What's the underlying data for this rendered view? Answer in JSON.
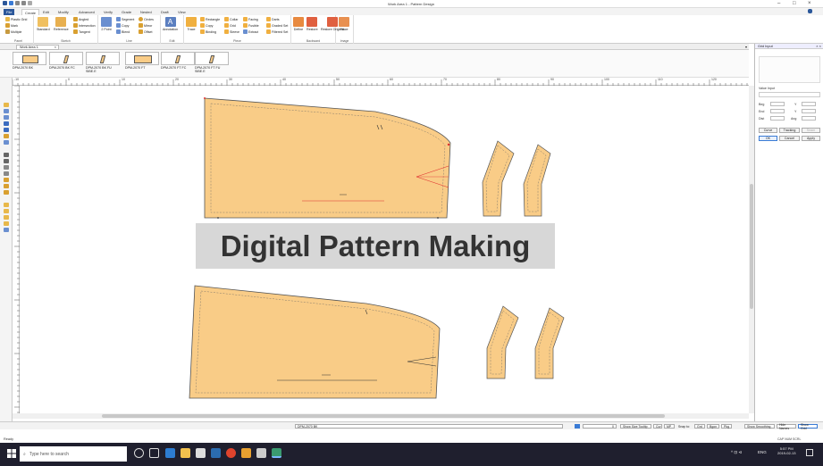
{
  "window": {
    "title": "Work Area 1 - Pattern Design"
  },
  "menu": {
    "items": [
      "File",
      "Create",
      "Edit",
      "Modify",
      "Advanced",
      "Verify",
      "Grade",
      "Nested",
      "Draft",
      "View"
    ]
  },
  "ribbon": {
    "groups": [
      {
        "label": "Panel",
        "items": [
          "Plastic Grid",
          "Mark",
          "Multiple"
        ]
      },
      {
        "label": "Sketch",
        "items": [
          "Standard",
          "Reference",
          "Angled",
          "Intersection",
          "Tangent"
        ]
      },
      {
        "label": "Line",
        "items": [
          "2 Point",
          "Segment",
          "Copy",
          "Blend",
          "Circles",
          "Mirror",
          "Offset"
        ]
      },
      {
        "label": "Edit",
        "items": [
          "Annotation"
        ]
      },
      {
        "label": "Piece",
        "items": [
          "Trace",
          "Rectangle",
          "Copy",
          "Binding",
          "Collar",
          "Grid",
          "Sleeve",
          "Facing",
          "Fusible",
          "Extract",
          "Darts",
          "Graded Set",
          "Filtered Set"
        ]
      },
      {
        "label": "Backward",
        "items": [
          "Define",
          "Restore",
          "Restore Original",
          "Defined"
        ]
      },
      {
        "label": "Image",
        "items": [
          "Place"
        ]
      }
    ]
  },
  "doc_tab": {
    "label": "Work Area 1"
  },
  "thumbnails": [
    {
      "label": "DPM-2070 BK"
    },
    {
      "label": "DPM-2070 BK FC"
    },
    {
      "label": "DPM-2070 BK FU SIBE.E"
    },
    {
      "label": "DPM-2070 FT"
    },
    {
      "label": "DPM-2070 FT FC"
    },
    {
      "label": "DPM-2070 FT FU SIBE.E"
    }
  ],
  "ruler_labels": [
    "-10",
    "0",
    "10",
    "20",
    "30",
    "40",
    "50",
    "60",
    "70",
    "80",
    "90",
    "100",
    "110",
    "120",
    "130",
    "140"
  ],
  "banner": {
    "text": "Digital Pattern Making"
  },
  "status_bar": {
    "piece_name": "DPM-2070 BK",
    "zoom": "0",
    "buttons": [
      "Show Size Tooltip",
      "Cur",
      "MP",
      "Snap to:",
      "Grd",
      "Bgon",
      "Pkg",
      "Show Smoothing",
      "Hide Names",
      "Show Grid"
    ]
  },
  "ready_text": "Ready",
  "caps_text": "CAP NUM SCRL",
  "right_panel": {
    "title": "Grid Input",
    "value_input_label": "Value Input",
    "fields": [
      {
        "label": "Beg",
        "axis": "Y"
      },
      {
        "label": "End",
        "axis": "Y"
      },
      {
        "label": "Dist",
        "axis": "Ang"
      }
    ],
    "mode_buttons": [
      "Curve",
      "Tracking",
      "Seam"
    ],
    "action_buttons": [
      "OK",
      "Cancel",
      "Apply"
    ]
  },
  "taskbar": {
    "search_placeholder": "Type here to search",
    "tray_lang": "ENG",
    "tray_time": "5:57 PM",
    "tray_date": "2019-02-13"
  },
  "colors": {
    "piece_fill": "#f9cc87",
    "piece_stroke": "#555555",
    "accent_red": "#e03030",
    "file_blue": "#2b579a"
  }
}
